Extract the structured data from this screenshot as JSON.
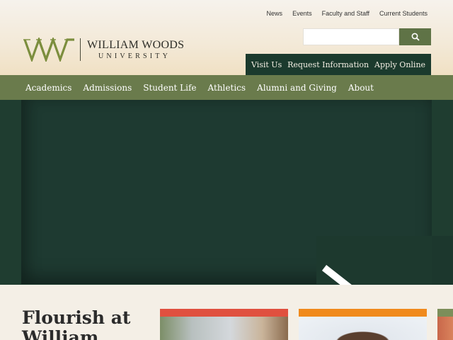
{
  "utility_nav": {
    "items": [
      "News",
      "Events",
      "Faculty and Staff",
      "Current Students"
    ]
  },
  "logo": {
    "name": "WILLIAM WOODS",
    "subtitle": "UNIVERSITY"
  },
  "search": {
    "placeholder": "",
    "value": "",
    "icon": "search-icon"
  },
  "cta": {
    "items": [
      "Visit Us",
      "Request Information",
      "Apply Online"
    ]
  },
  "main_nav": {
    "items": [
      "Academics",
      "Admissions",
      "Student Life",
      "Athletics",
      "Alumni and Giving",
      "About"
    ]
  },
  "lower": {
    "heading": "Flourish at William"
  },
  "colors": {
    "nav_green": "#6a7b4c",
    "hero_dark_green": "#1f3d30",
    "cta_green": "#1b3a2d",
    "card_red": "#e0503f",
    "card_orange": "#f08a1c",
    "card_olive": "#7c8e5a"
  }
}
